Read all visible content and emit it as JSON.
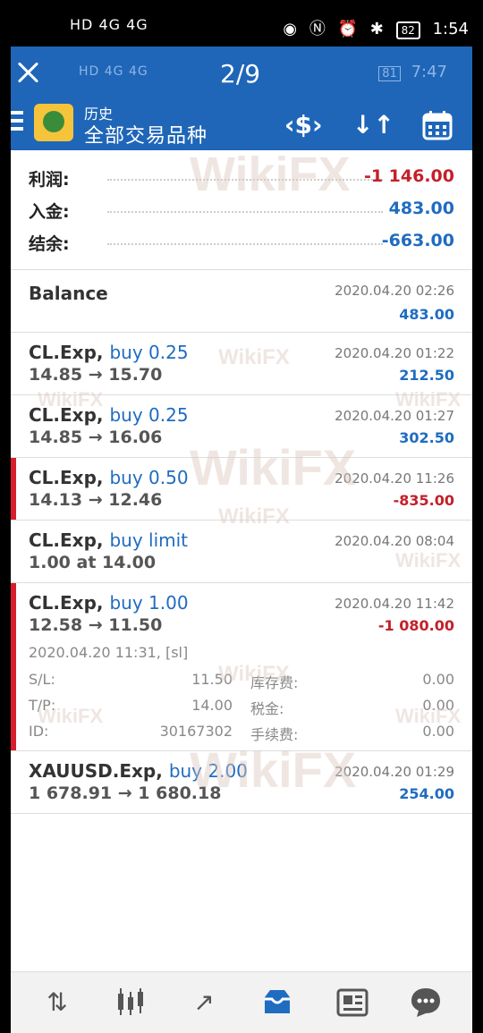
{
  "status_bar": {
    "left_text": "HD 4G 4G",
    "time": "1:54",
    "battery": "82"
  },
  "viewer": {
    "counter": "2/9",
    "inner_left": "HD 4G 4G",
    "inner_time": "7:47",
    "inner_battery": "81"
  },
  "header": {
    "subtitle": "历史",
    "title": "全部交易品种"
  },
  "summary": [
    {
      "label": "利润:",
      "value": "-1 146.00",
      "color": "#c4202a"
    },
    {
      "label": "入金:",
      "value": "483.00",
      "color": "#1f6cc1"
    },
    {
      "label": "结余:",
      "value": "-663.00",
      "color": "#1f6cc1"
    }
  ],
  "deals": [
    {
      "symbol": "Balance",
      "action": "",
      "prices": "",
      "time": "2020.04.20 02:26",
      "pl": "483.00",
      "pl_color": "#1f6cc1"
    },
    {
      "symbol": "CL.Exp,",
      "action": "buy 0.25",
      "prices": "14.85 → 15.70",
      "time": "2020.04.20 01:22",
      "pl": "212.50",
      "pl_color": "#1f6cc1"
    },
    {
      "symbol": "CL.Exp,",
      "action": "buy 0.25",
      "prices": "14.85 → 16.06",
      "time": "2020.04.20 01:27",
      "pl": "302.50",
      "pl_color": "#1f6cc1"
    },
    {
      "symbol": "CL.Exp,",
      "action": "buy 0.50",
      "prices": "14.13 → 12.46",
      "time": "2020.04.20 11:26",
      "pl": "-835.00",
      "pl_color": "#c4202a"
    },
    {
      "symbol": "CL.Exp,",
      "action": "buy limit",
      "prices": "1.00 at 14.00",
      "time": "2020.04.20 08:04",
      "pl": "",
      "pl_color": "#1f6cc1"
    },
    {
      "symbol": "CL.Exp,",
      "action": "buy 1.00",
      "prices": "12.58 → 11.50",
      "time": "2020.04.20 11:42",
      "pl": "-1 080.00",
      "pl_color": "#c4202a",
      "open_info": "2020.04.20 11:31, [sl]",
      "details": [
        {
          "l": "S/L:",
          "v": "11.50",
          "l2": "库存费:",
          "v2": "0.00"
        },
        {
          "l": "T/P:",
          "v": "14.00",
          "l2": "税金:",
          "v2": "0.00"
        },
        {
          "l": "ID:",
          "v": "30167302",
          "l2": "手续费:",
          "v2": "0.00"
        }
      ]
    },
    {
      "symbol": "XAUUSD.Exp,",
      "action": "buy 2.00",
      "prices": "1 678.91 → 1 680.18",
      "time": "2020.04.20 01:29",
      "pl": "254.00",
      "pl_color": "#1f6cc1"
    }
  ],
  "watermark": "WikiFX",
  "icons": {
    "nav": [
      "quotes-icon",
      "chart-icon",
      "trade-icon",
      "history-icon",
      "news-icon",
      "chat-icon"
    ]
  }
}
